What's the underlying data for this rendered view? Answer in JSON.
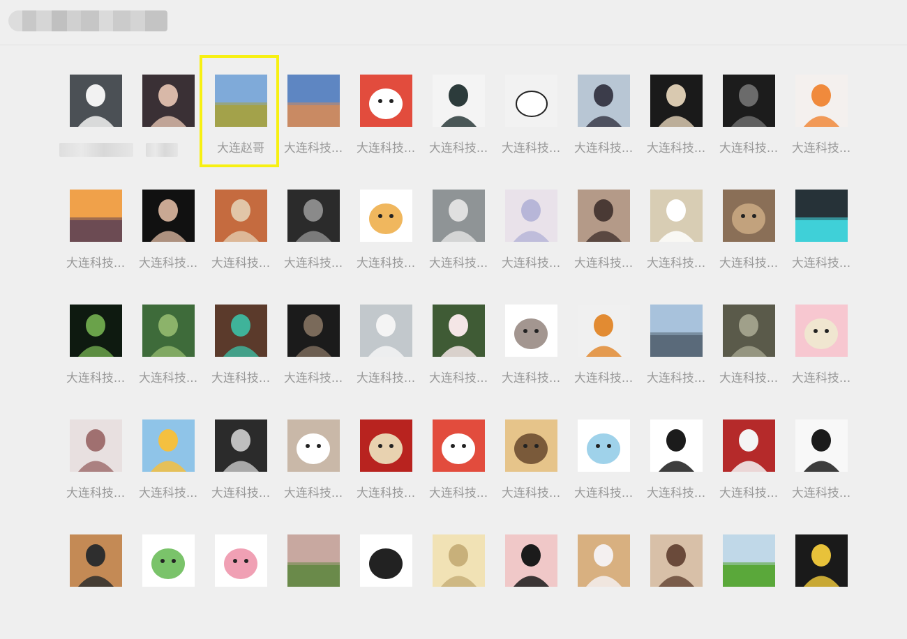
{
  "header": {
    "title": "",
    "title_redacted": true
  },
  "highlight": {
    "color": "#f7f012",
    "target_index": 2
  },
  "contacts": [
    {
      "name": "",
      "redacted": true,
      "avatar": "woman-white-dress",
      "colors": [
        "#4b5055",
        "#f2f2f2"
      ]
    },
    {
      "name": "",
      "redacted": true,
      "avatar": "woman-long-hair-flowers",
      "colors": [
        "#3a3035",
        "#d8b8a8"
      ]
    },
    {
      "name": "大连赵哥",
      "avatar": "field-blue-sky",
      "colors": [
        "#7faad9",
        "#a3a24a"
      ]
    },
    {
      "name": "大连科技...",
      "avatar": "mountain-sunset",
      "colors": [
        "#5e86c2",
        "#c98a63"
      ]
    },
    {
      "name": "大连科技...",
      "avatar": "cartoon-cat-red-circle",
      "colors": [
        "#e24c3d",
        "#ffffff"
      ]
    },
    {
      "name": "大连科技...",
      "avatar": "anime-girl-dark-hair",
      "colors": [
        "#f4f4f4",
        "#2c3b3b"
      ]
    },
    {
      "name": "大连科技...",
      "avatar": "blank-round-face-sketch",
      "colors": [
        "#f2f2f2",
        "#222222"
      ]
    },
    {
      "name": "大连科技...",
      "avatar": "anime-boy-white-hair",
      "colors": [
        "#b8c6d4",
        "#3b3c4a"
      ]
    },
    {
      "name": "大连科技...",
      "avatar": "man-black-hat",
      "colors": [
        "#1a1a1a",
        "#d9c9b0"
      ]
    },
    {
      "name": "大连科技...",
      "avatar": "dark-hand-photo",
      "colors": [
        "#1c1c1c",
        "#6b6b6b"
      ]
    },
    {
      "name": "大连科技...",
      "avatar": "anime-orange-hoodie",
      "colors": [
        "#f4f0ee",
        "#f08a3c"
      ]
    },
    {
      "name": "大连科技...",
      "avatar": "city-sunset",
      "colors": [
        "#f0a14a",
        "#6c4b53"
      ]
    },
    {
      "name": "大连科技...",
      "avatar": "manga-boy-dark",
      "colors": [
        "#111111",
        "#c9a893"
      ]
    },
    {
      "name": "大连科技...",
      "avatar": "man-eating-noodles",
      "colors": [
        "#c56b3f",
        "#e1c6a8"
      ]
    },
    {
      "name": "大连科技...",
      "avatar": "dark-stairs-figure",
      "colors": [
        "#2b2b2b",
        "#8a8a8a"
      ]
    },
    {
      "name": "大连科技...",
      "avatar": "cat-jar-sticker",
      "colors": [
        "#ffffff",
        "#f0b75e"
      ]
    },
    {
      "name": "大连科技...",
      "avatar": "anime-gray-hair",
      "colors": [
        "#8f9496",
        "#e0e0e0"
      ]
    },
    {
      "name": "大连科技...",
      "avatar": "anime-white-hair-girl",
      "colors": [
        "#e9e2ea",
        "#b7b6d8"
      ]
    },
    {
      "name": "大连科技...",
      "avatar": "girl-room-photo",
      "colors": [
        "#b49a88",
        "#4a3a35"
      ]
    },
    {
      "name": "大连科技...",
      "avatar": "hello-kitty-laptop",
      "colors": [
        "#d8cdb4",
        "#ffffff"
      ]
    },
    {
      "name": "大连科技...",
      "avatar": "dog-blanket",
      "colors": [
        "#8a6f57",
        "#c2a27d"
      ]
    },
    {
      "name": "大连科技...",
      "avatar": "anime-dark-teal",
      "colors": [
        "#263238",
        "#3fd0d8"
      ]
    },
    {
      "name": "大连科技...",
      "avatar": "forest-figure-dark",
      "colors": [
        "#0e1a10",
        "#6aa24a"
      ]
    },
    {
      "name": "大连科技...",
      "avatar": "person-lying-grass",
      "colors": [
        "#3e6b3a",
        "#8cb36a"
      ]
    },
    {
      "name": "大连科技...",
      "avatar": "child-green-shirt",
      "colors": [
        "#5b3a2b",
        "#3fb39a"
      ]
    },
    {
      "name": "大连科技...",
      "avatar": "silhouette-window",
      "colors": [
        "#1b1b1b",
        "#7a6a5a"
      ]
    },
    {
      "name": "大连科技...",
      "avatar": "anime-white-hair-boy",
      "colors": [
        "#c2c8cc",
        "#f4f4f4"
      ]
    },
    {
      "name": "大连科技...",
      "avatar": "woman-garden",
      "colors": [
        "#3f5b35",
        "#f4e6e6"
      ]
    },
    {
      "name": "大连科技...",
      "avatar": "penguin-cartoon",
      "colors": [
        "#ffffff",
        "#a39690"
      ]
    },
    {
      "name": "大连科技...",
      "avatar": "anime-pirate-hat",
      "colors": [
        "#f0f0f0",
        "#e28b32"
      ]
    },
    {
      "name": "大连科技...",
      "avatar": "beach-seaside",
      "colors": [
        "#a8c2dc",
        "#5a6a7a"
      ]
    },
    {
      "name": "大连科技...",
      "avatar": "dragon-dark",
      "colors": [
        "#5a5a4a",
        "#a0a08a"
      ]
    },
    {
      "name": "大连科技...",
      "avatar": "pink-pig-stripes",
      "colors": [
        "#f7c7d0",
        "#f0e6d0"
      ]
    },
    {
      "name": "大连科技...",
      "avatar": "girl-lace-headdress",
      "colors": [
        "#e8e0e0",
        "#a07070"
      ]
    },
    {
      "name": "大连科技...",
      "avatar": "anime-blonde-girl",
      "colors": [
        "#8fc4e8",
        "#f4c040"
      ]
    },
    {
      "name": "大连科技...",
      "avatar": "lu-xun-portrait",
      "colors": [
        "#2b2b2b",
        "#bfbfbf"
      ]
    },
    {
      "name": "大连科技...",
      "avatar": "white-cat-glasses",
      "colors": [
        "#c9b8a8",
        "#ffffff"
      ]
    },
    {
      "name": "大连科技...",
      "avatar": "dog-laptop-red",
      "colors": [
        "#b8231f",
        "#e8d2b0"
      ]
    },
    {
      "name": "大连科技...",
      "avatar": "cartoon-cat-red-circle",
      "colors": [
        "#e24c3d",
        "#ffffff"
      ]
    },
    {
      "name": "大连科技...",
      "avatar": "child-cartoon-door",
      "colors": [
        "#e6c48a",
        "#7a5a3a"
      ]
    },
    {
      "name": "大连科技...",
      "avatar": "bear-reading-pink",
      "colors": [
        "#ffffff",
        "#9fd2ea"
      ]
    },
    {
      "name": "大连科技...",
      "avatar": "manga-ponytail-girl",
      "colors": [
        "#ffffff",
        "#1b1b1b"
      ]
    },
    {
      "name": "大连科技...",
      "avatar": "china-red-wall",
      "colors": [
        "#b52a2a",
        "#f4f4f4"
      ]
    },
    {
      "name": "大连科技...",
      "avatar": "manga-glasses-boy",
      "colors": [
        "#f8f8f8",
        "#1b1b1b"
      ]
    },
    {
      "name": "",
      "avatar": "woman-restaurant",
      "colors": [
        "#c48a55",
        "#2e2e2e"
      ]
    },
    {
      "name": "",
      "avatar": "green-monster-sticker",
      "colors": [
        "#ffffff",
        "#7ac36a"
      ]
    },
    {
      "name": "",
      "avatar": "pink-cat-fire-eyes",
      "colors": [
        "#ffffff",
        "#f0a0b4"
      ]
    },
    {
      "name": "",
      "avatar": "field-path-girl",
      "colors": [
        "#c8a8a0",
        "#6a8a4a"
      ]
    },
    {
      "name": "",
      "avatar": "white-dog-fire-eyes",
      "colors": [
        "#ffffff",
        "#222222"
      ]
    },
    {
      "name": "",
      "avatar": "blonde-hair-closeup",
      "colors": [
        "#f1e2b5",
        "#c8b07a"
      ]
    },
    {
      "name": "",
      "avatar": "anime-dark-bob",
      "colors": [
        "#f0c8c8",
        "#1b1b1b"
      ]
    },
    {
      "name": "",
      "avatar": "anime-silver-hair",
      "colors": [
        "#d8b080",
        "#f4f0f0"
      ]
    },
    {
      "name": "",
      "avatar": "anime-girl-goggles",
      "colors": [
        "#d8c0a8",
        "#6a4a3a"
      ]
    },
    {
      "name": "",
      "avatar": "tea-leaves",
      "colors": [
        "#c0d8e8",
        "#5aa83a"
      ]
    },
    {
      "name": "",
      "avatar": "kamen-rider-dark",
      "colors": [
        "#1a1a1a",
        "#e8c23a"
      ]
    }
  ]
}
